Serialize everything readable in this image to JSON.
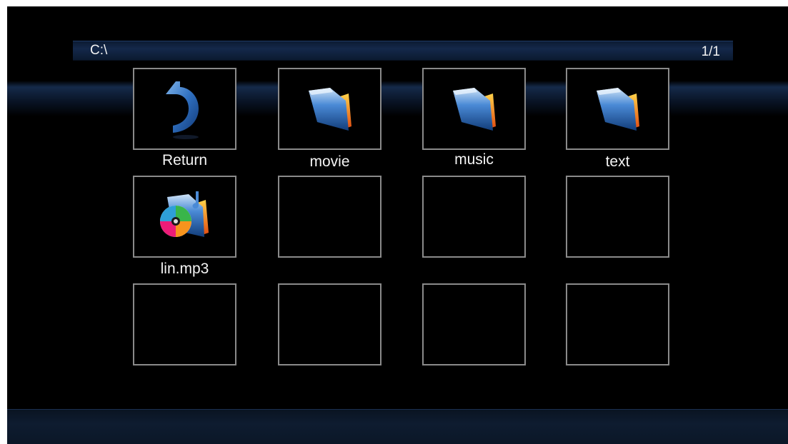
{
  "path_bar": {
    "path": "C:\\",
    "page": "1/1"
  },
  "tiles": [
    {
      "label": "Return",
      "icon": "return-arrow-icon"
    },
    {
      "label": "movie",
      "icon": "folder-icon"
    },
    {
      "label": "music",
      "icon": "folder-icon"
    },
    {
      "label": "text",
      "icon": "folder-icon"
    },
    {
      "label": "lin.mp3",
      "icon": "music-file-icon"
    },
    {
      "label": "",
      "icon": ""
    },
    {
      "label": "",
      "icon": ""
    },
    {
      "label": "",
      "icon": ""
    },
    {
      "label": "",
      "icon": ""
    },
    {
      "label": "",
      "icon": ""
    },
    {
      "label": "",
      "icon": ""
    },
    {
      "label": "",
      "icon": ""
    }
  ],
  "colors": {
    "background": "#000000",
    "tile_border": "#8a8a8a",
    "bar_blue": "#14284a",
    "text": "#f2f2f2"
  }
}
